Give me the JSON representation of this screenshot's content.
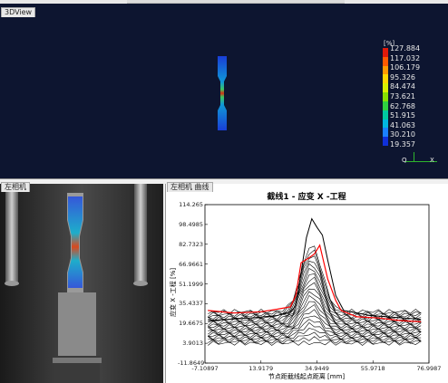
{
  "panels": {
    "view3d_title": "3DView",
    "camera_title": "左相机",
    "curve_tab_title": "左相机 曲线"
  },
  "legend": {
    "unit": "[%]",
    "values": [
      "127.884",
      "117.032",
      "106.179",
      "95.326",
      "84.474",
      "73.621",
      "62.768",
      "51.915",
      "41.063",
      "30.210",
      "19.357"
    ],
    "colors": [
      "#e01a0a",
      "#ff5a00",
      "#ff9a00",
      "#ffd800",
      "#d8f000",
      "#86e000",
      "#2fd040",
      "#00c9a0",
      "#00b6e0",
      "#1a80ff",
      "#1030d8"
    ]
  },
  "axes3d": {
    "x": "X",
    "z": "Q"
  },
  "chart_data": {
    "type": "line",
    "title": "截线1 - 应变 X -工程",
    "xlabel": "节点距截线起点距离 [mm]",
    "ylabel": "应变 X -工程 [%]",
    "xlim": [
      -7.10897,
      76.9987
    ],
    "ylim": [
      -11.8649,
      114.265
    ],
    "x_ticks": [
      "-7.10897",
      "13.9179",
      "34.9449",
      "55.9718",
      "76.9987"
    ],
    "y_ticks": [
      "114.265",
      "98.4985",
      "82.7323",
      "66.9661",
      "51.1999",
      "35.4337",
      "19.6675",
      "3.9013",
      "-11.8649"
    ],
    "series": [
      {
        "color": "#ff0000",
        "x": [
          -6,
          4,
          14,
          20,
          25,
          27,
          29,
          32,
          34,
          36,
          39,
          42,
          44,
          50,
          58,
          66,
          74
        ],
        "y": [
          30,
          28,
          29,
          31,
          33,
          42,
          68,
          72,
          75,
          82,
          55,
          38,
          30,
          25,
          24,
          22,
          21
        ]
      },
      {
        "color": "#000000",
        "x": [
          -6,
          10,
          20,
          25,
          27,
          29,
          31,
          33,
          35,
          37,
          39,
          42,
          45,
          55,
          74
        ],
        "y": [
          22,
          24,
          26,
          29,
          34,
          60,
          88,
          103,
          96,
          90,
          70,
          42,
          30,
          26,
          23
        ]
      }
    ]
  }
}
